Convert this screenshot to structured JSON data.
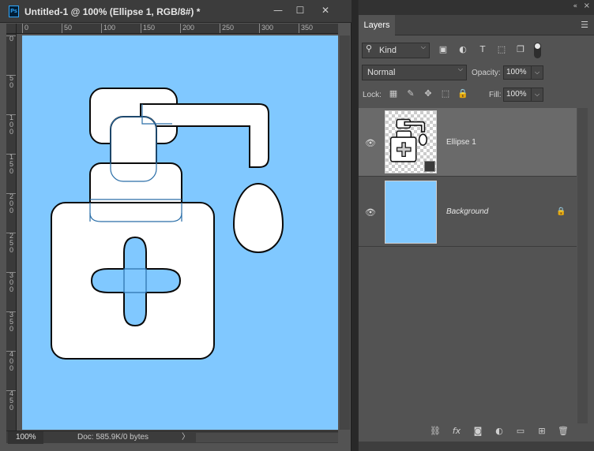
{
  "document": {
    "title": "Untitled-1 @ 100% (Ellipse 1, RGB/8#) *",
    "app_badge": "Ps",
    "window_controls": {
      "minimize": "—",
      "maximize": "☐",
      "close": "✕"
    },
    "ruler_h_labels": [
      "0",
      "50",
      "100",
      "150",
      "200",
      "250",
      "300",
      "350"
    ],
    "ruler_v_labels": [
      [
        "0"
      ],
      [
        "5",
        "0"
      ],
      [
        "1",
        "0",
        "0"
      ],
      [
        "1",
        "5",
        "0"
      ],
      [
        "2",
        "0",
        "0"
      ],
      [
        "2",
        "5",
        "0"
      ],
      [
        "3",
        "0",
        "0"
      ],
      [
        "3",
        "5",
        "0"
      ],
      [
        "4",
        "0",
        "0"
      ],
      [
        "4",
        "5",
        "0"
      ]
    ],
    "canvas_color": "#80c8ff",
    "status": {
      "zoom": "100%",
      "doc_info": "Doc: 585.9K/0 bytes",
      "arrow": "〉"
    }
  },
  "panel": {
    "tab": "Layers",
    "collapse": "«",
    "close": "×",
    "menu": "☰",
    "filter": {
      "kind_label": "Kind",
      "search_icon": "search-icon",
      "chevron": "⌵"
    },
    "filter_icons": [
      "image-filter-icon",
      "adjustment-filter-icon",
      "type-filter-icon",
      "shape-filter-icon",
      "smartobject-filter-icon"
    ],
    "blend_mode": "Normal",
    "opacity_label": "Opacity:",
    "opacity_value": "100%",
    "lock_label": "Lock:",
    "fill_label": "Fill:",
    "fill_value": "100%",
    "lock_icons": [
      "lock-transparent-icon",
      "lock-image-icon",
      "lock-position-icon",
      "lock-artboard-icon",
      "lock-all-icon"
    ],
    "layers": [
      {
        "name": "Ellipse 1",
        "visible": true,
        "selected": true,
        "italic": false,
        "locked": false
      },
      {
        "name": "Background",
        "visible": true,
        "selected": false,
        "italic": true,
        "locked": true,
        "thumb_color": "#80c8ff"
      }
    ],
    "bottom_icons": [
      "link-icon",
      "fx-icon",
      "mask-icon",
      "adjustment-icon",
      "folder-icon",
      "new-layer-icon",
      "trash-icon"
    ]
  }
}
